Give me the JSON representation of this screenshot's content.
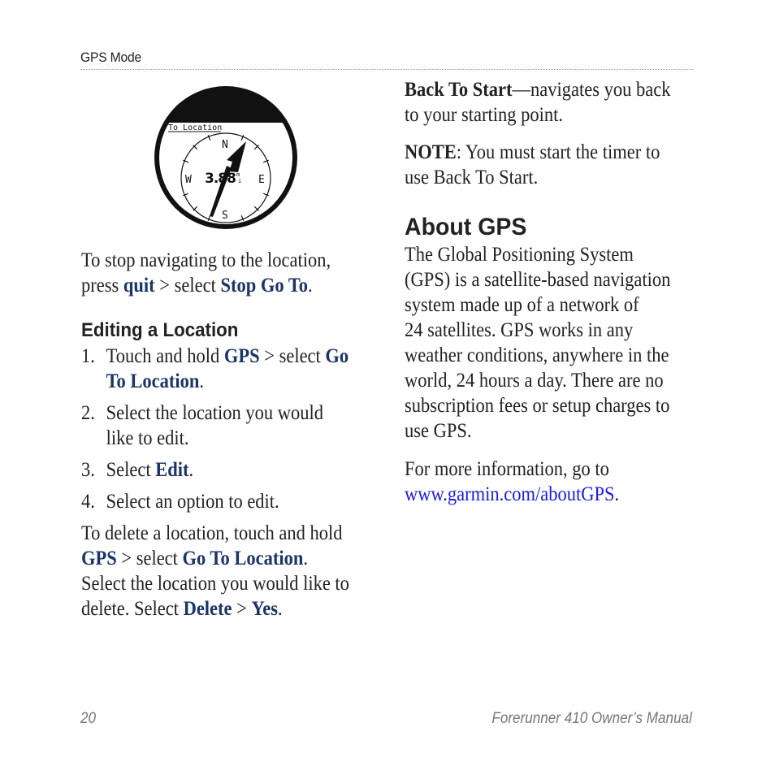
{
  "header": {
    "running_head": "GPS Mode"
  },
  "device_screen": {
    "title": "To Location",
    "distance": "3.88",
    "unit_top": "m",
    "unit_bottom": "i",
    "compass": {
      "n": "N",
      "e": "E",
      "s": "S",
      "w": "W"
    },
    "icon": "compass-arrow-icon"
  },
  "left_column": {
    "stop_nav": {
      "text1": "To stop navigating to the location,",
      "text2": "press ",
      "kw1": "quit",
      "text3": " > select ",
      "kw2": "Stop Go To",
      "text4": "."
    },
    "editing_heading": "Editing a Location",
    "steps": [
      {
        "num": "1.",
        "line1_a": "Touch and hold ",
        "line1_kw1": "GPS",
        "line1_b": " > select ",
        "line1_kw2": "Go",
        "line2_kw": "To Location",
        "line2_end": "."
      },
      {
        "num": "2.",
        "line1": "Select the location you would",
        "line2": "like to edit."
      },
      {
        "num": "3.",
        "text": "Select ",
        "kw": "Edit",
        "end": "."
      },
      {
        "num": "4.",
        "text": "Select an option to edit."
      }
    ],
    "delete_para": {
      "line1": "To delete a location, touch and hold",
      "kw1": "GPS",
      "t2": " > select ",
      "kw2": "Go To Location",
      "t3": ".",
      "line3": "Select the location you would like to",
      "t4": "delete. Select ",
      "kw3": "Delete",
      "t5": " > ",
      "kw4": "Yes",
      "t6": "."
    }
  },
  "right_column": {
    "back_to_start": {
      "term": "Back To Start",
      "line1_rest": "—navigates you back",
      "line2": "to your starting point."
    },
    "note": {
      "label": "NOTE",
      "line1_rest": ": You must start the timer to",
      "line2": "use Back To Start."
    },
    "about_heading": "About GPS",
    "about_lines": [
      "The Global Positioning System",
      "(GPS) is a satellite-based navigation",
      "system made up of a network of",
      "24 satellites. GPS works in any",
      "weather conditions, anywhere in the",
      "world, 24 hours a day. There are no",
      "subscription fees or setup charges to",
      "use GPS."
    ],
    "more_info": {
      "line1": "For more information, go to",
      "link": "www.garmin.com/aboutGPS",
      "end": "."
    }
  },
  "footer": {
    "page_number": "20",
    "manual_title": "Forerunner 410 Owner’s Manual"
  },
  "colors": {
    "keyword": "#1b3566",
    "link": "#1a1ae6",
    "text": "#222222",
    "footer": "#777777"
  }
}
